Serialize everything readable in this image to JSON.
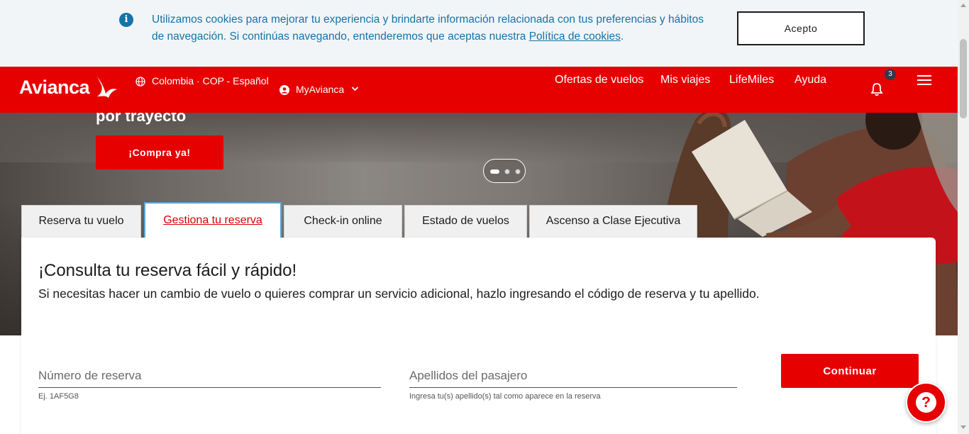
{
  "cookie_banner": {
    "text": "Utilizamos cookies para mejorar tu experiencia y brindarte información relacionada con tus preferencias y hábitos de navegación. Si continúas navegando, entenderemos que aceptas nuestra ",
    "link_label": "Política de cookies",
    "text_end": ".",
    "accept_label": "Acepto"
  },
  "header": {
    "logo": "Avianca",
    "region": "Colombia · COP - Español",
    "account": "MyAvianca",
    "nav": [
      "Ofertas de vuelos",
      "Mis viajes",
      "LifeMiles",
      "Ayuda"
    ],
    "notifications_count": "3"
  },
  "hero": {
    "heading_fragment": "por trayecto",
    "cta_label": "¡Compra ya!",
    "slides_total": 3,
    "active_slide": 1
  },
  "tabs": [
    {
      "label": "Reserva tu vuelo"
    },
    {
      "label": "Gestiona tu reserva",
      "active": true
    },
    {
      "label": "Check-in online"
    },
    {
      "label": "Estado de vuelos"
    },
    {
      "label": "Ascenso a Clase Ejecutiva"
    }
  ],
  "panel": {
    "title": "¡Consulta tu reserva fácil y rápido!",
    "description": "Si necesitas hacer un cambio de vuelo o quieres comprar un servicio adicional, hazlo ingresando el código de reserva y tu apellido.",
    "booking_field": {
      "placeholder": "Número de reserva",
      "value": "",
      "hint": "Ej. 1AF5G8"
    },
    "surname_field": {
      "placeholder": "Apellidos del pasajero",
      "value": "",
      "hint": "Ingresa tu(s) apellido(s) tal como aparece en la reserva"
    },
    "submit_label": "Continuar"
  },
  "help": {
    "icon": "question-mark-icon"
  },
  "colors": {
    "brand_red": "#e60000",
    "cookie_blue": "#1673a8",
    "tab_active_border": "#59a6d6"
  }
}
